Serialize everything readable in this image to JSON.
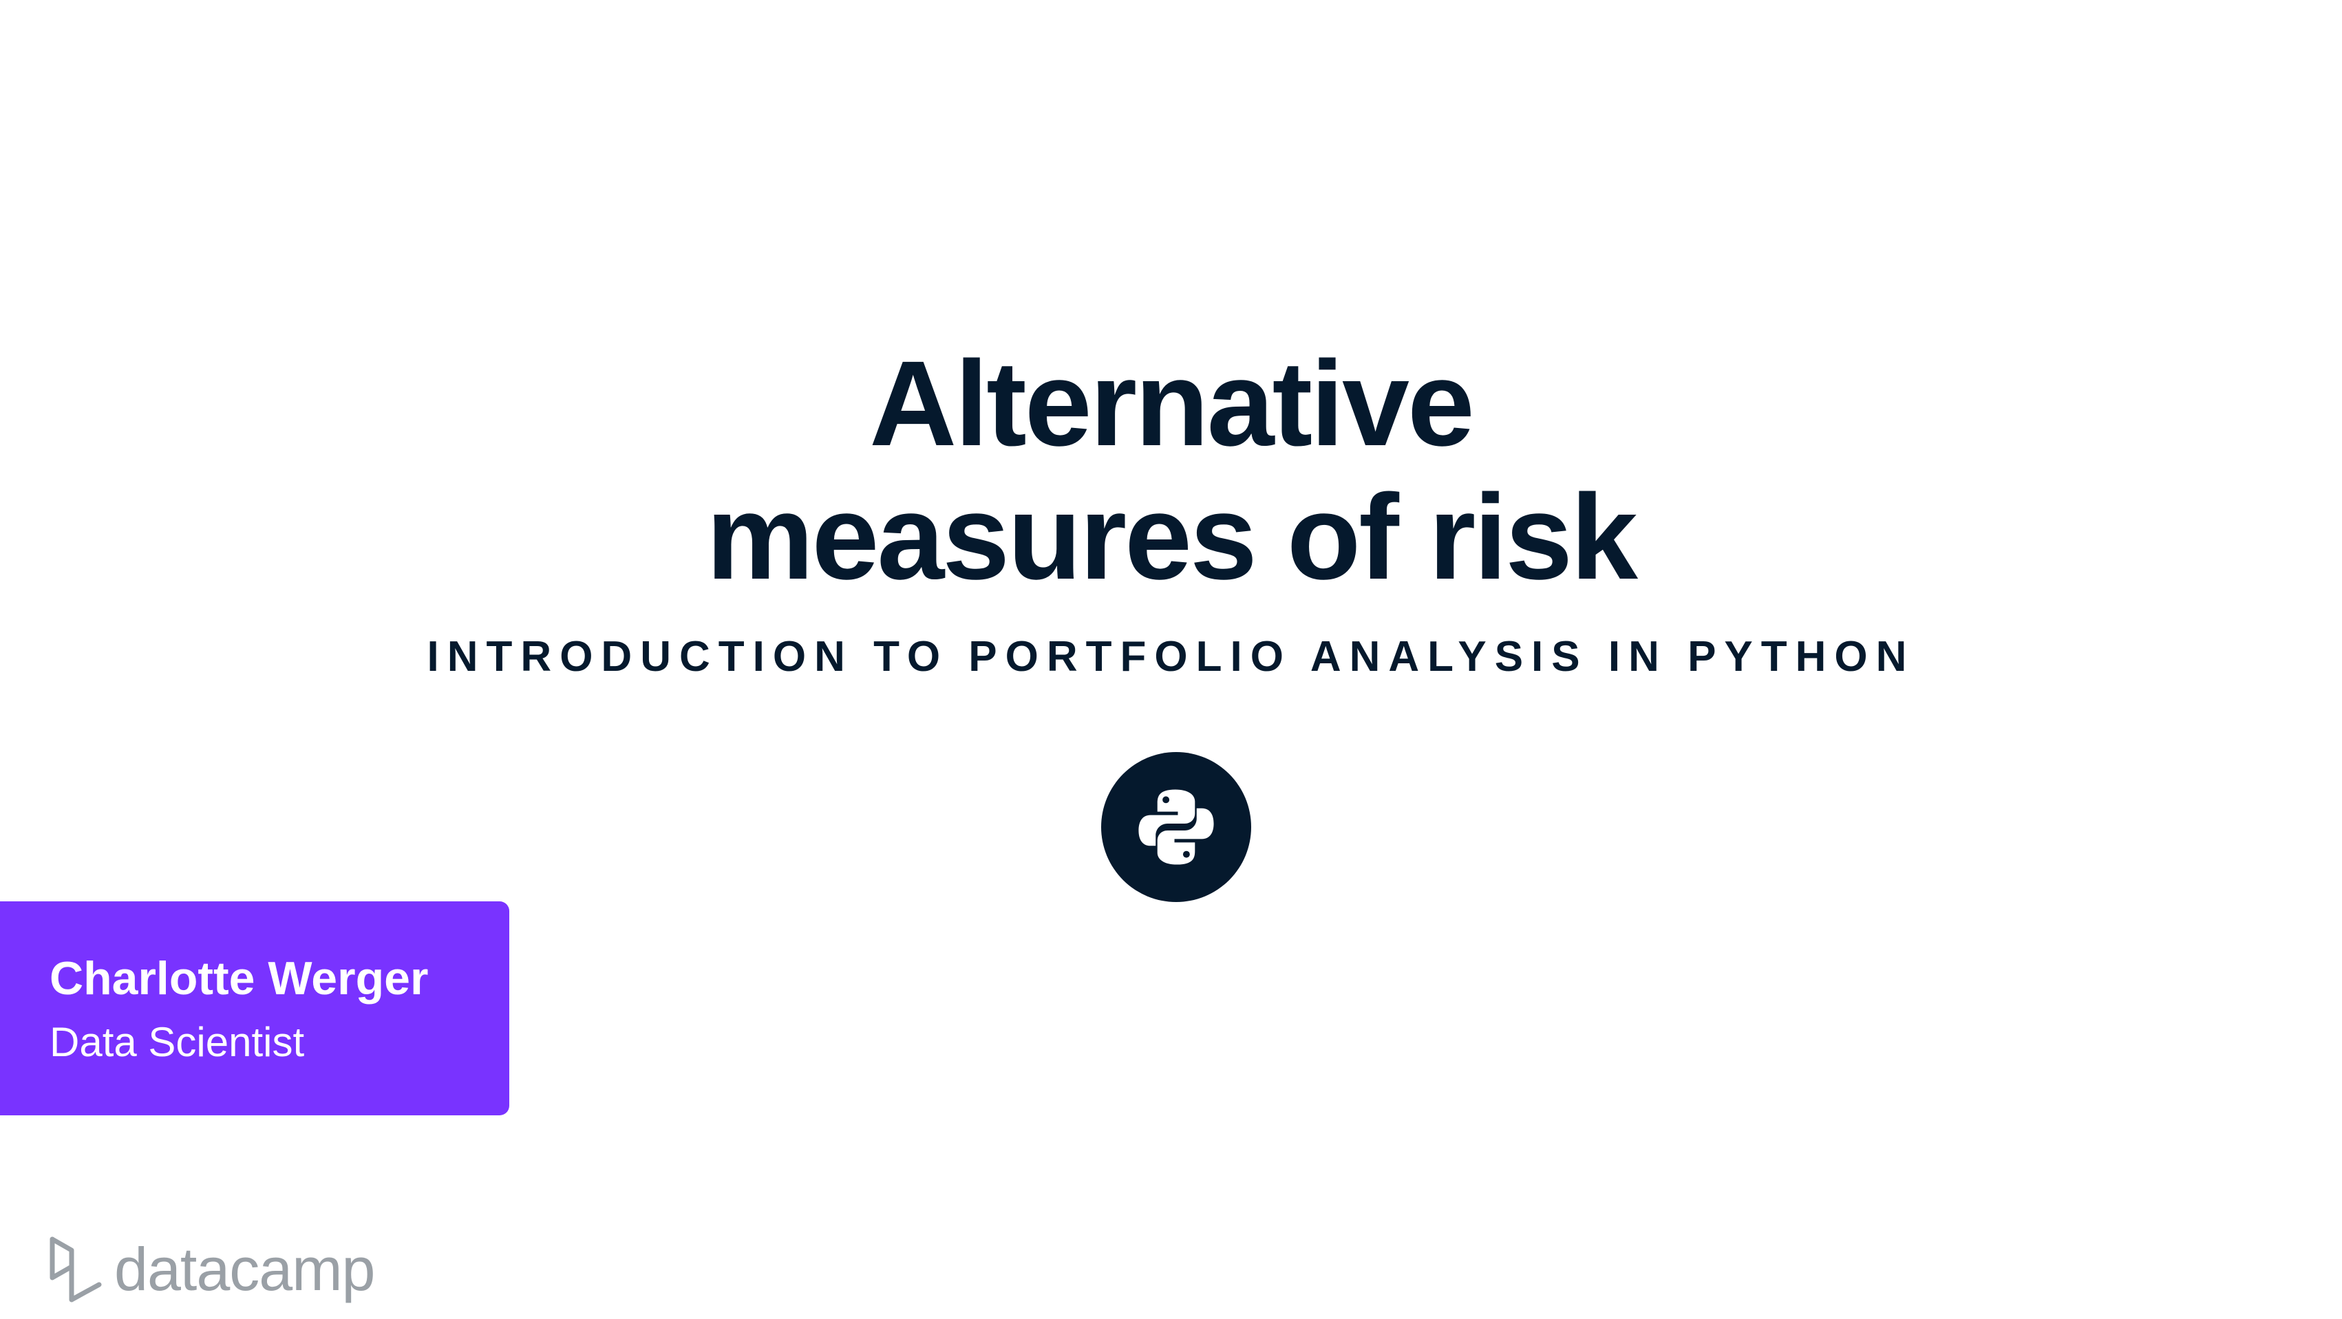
{
  "slide": {
    "title_line1": "Alternative",
    "title_line2": "measures of risk",
    "course": "INTRODUCTION TO PORTFOLIO ANALYSIS IN PYTHON",
    "icon": "python-logo-icon"
  },
  "presenter": {
    "name": "Charlotte Werger",
    "role": "Data Scientist"
  },
  "brand": {
    "name": "datacamp",
    "icon": "datacamp-logo-icon"
  },
  "colors": {
    "text": "#05192d",
    "accent": "#7933ff",
    "brand_gray": "#9aa0a6",
    "background": "#ffffff"
  }
}
